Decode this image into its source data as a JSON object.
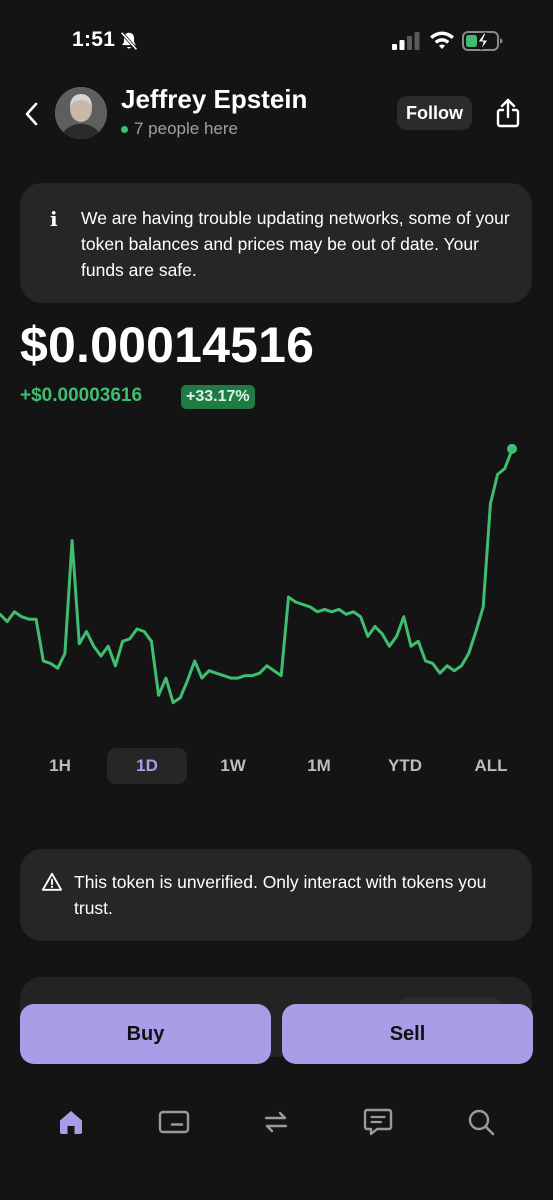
{
  "status_bar": {
    "time": "1:51",
    "icons": [
      "bell-muted-icon",
      "signal-icon",
      "wifi-icon",
      "battery-charging-icon"
    ]
  },
  "header": {
    "back_icon": "chevron-left-icon",
    "avatar_icon": "avatar-icon",
    "token_name": "Jeffrey Epstein",
    "presence_text": "7 people here",
    "follow_label": "Follow",
    "share_icon": "share-icon"
  },
  "info_banner": {
    "icon": "info-icon",
    "icon_glyph": "i",
    "text": "We are having trouble updating networks, some of your token balances and prices may be out of date. Your funds are safe."
  },
  "price": {
    "value": "$0.00014516",
    "change": "+$0.00003616",
    "change_percent": "+33.17%"
  },
  "chart_data": {
    "type": "line",
    "title": "",
    "xlabel": "",
    "ylabel": "",
    "series": [
      {
        "values": [
          0.0001095,
          0.000108,
          0.00011,
          0.000109,
          0.0001085,
          0.0001085,
          0.0001,
          9.95e-05,
          9.85e-05,
          0.0001015,
          0.0001245,
          0.0001035,
          0.000106,
          0.000103,
          0.000101,
          0.000103,
          9.9e-05,
          0.000104,
          0.0001045,
          0.0001065,
          0.000106,
          0.000104,
          9.3e-05,
          9.65e-05,
          9.15e-05,
          9.25e-05,
          9.6e-05,
          0.0001,
          9.65e-05,
          9.8e-05,
          9.75e-05,
          9.7e-05,
          9.65e-05,
          9.65e-05,
          9.7e-05,
          9.7e-05,
          9.75e-05,
          9.9e-05,
          9.8e-05,
          9.7e-05,
          0.000113,
          0.000112,
          0.0001115,
          0.000111,
          0.00011,
          0.0001105,
          0.00011,
          0.0001105,
          0.0001095,
          0.00011,
          0.000109,
          0.000105,
          0.000107,
          0.0001055,
          0.000103,
          0.000105,
          0.000109,
          0.000103,
          0.000104,
          0.0001,
          9.95e-05,
          9.75e-05,
          9.9e-05,
          9.8e-05,
          9.9e-05,
          0.0001015,
          0.000106,
          0.000111,
          0.000132,
          0.000138,
          0.0001392,
          0.000143
        ]
      }
    ],
    "latest_point": 0.000143,
    "range": "1D",
    "grid": false,
    "legend": "none",
    "line_color": "#3fbd70"
  },
  "range_tabs": {
    "items": [
      {
        "label": "1H",
        "active": false
      },
      {
        "label": "1D",
        "active": true
      },
      {
        "label": "1W",
        "active": false
      },
      {
        "label": "1M",
        "active": false
      },
      {
        "label": "YTD",
        "active": false
      },
      {
        "label": "ALL",
        "active": false
      }
    ]
  },
  "warning_banner": {
    "icon": "warning-icon",
    "text": "This token is unverified. Only interact with tokens you trust."
  },
  "actions": {
    "buy_label": "Buy",
    "sell_label": "Sell"
  },
  "bottom_nav": {
    "items": [
      {
        "icon": "home-icon",
        "active": true
      },
      {
        "icon": "wallet-card-icon",
        "active": false
      },
      {
        "icon": "swap-icon",
        "active": false
      },
      {
        "icon": "chat-icon",
        "active": false
      },
      {
        "icon": "search-icon",
        "active": false
      }
    ]
  },
  "colors": {
    "background": "#141414",
    "card": "#262626",
    "accent": "#a89ee8",
    "positive": "#3fbd70",
    "positive_badge": "#1f7a44",
    "muted_text": "#a0a0a0"
  }
}
